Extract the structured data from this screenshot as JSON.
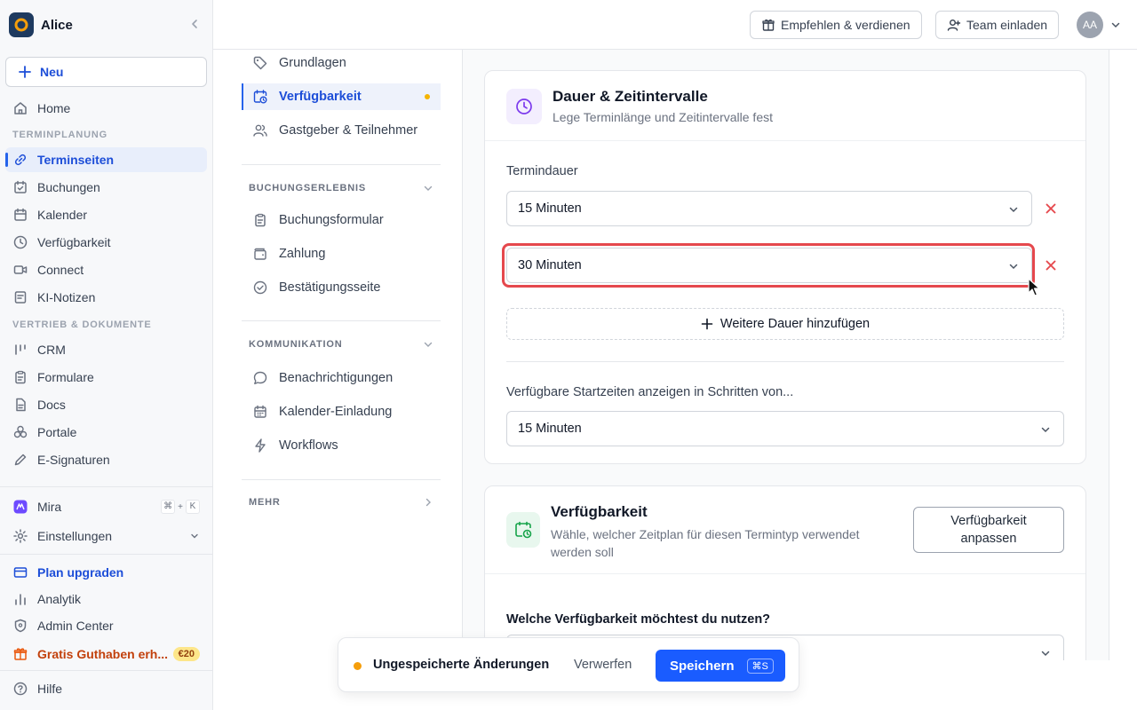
{
  "workspace": {
    "name": "Alice"
  },
  "sidebar": {
    "new_label": "Neu",
    "home": "Home",
    "section_scheduling": "TERMINPLANUNG",
    "scheduling_items": [
      {
        "label": "Terminseiten",
        "icon": "link-icon",
        "active": true
      },
      {
        "label": "Buchungen",
        "icon": "calendar-check-icon"
      },
      {
        "label": "Kalender",
        "icon": "calendar-icon"
      },
      {
        "label": "Verfügbarkeit",
        "icon": "clock-icon"
      },
      {
        "label": "Connect",
        "icon": "video-icon"
      },
      {
        "label": "KI-Notizen",
        "icon": "notes-icon"
      }
    ],
    "section_sales": "VERTRIEB & DOKUMENTE",
    "sales_items": [
      {
        "label": "CRM",
        "icon": "crm-icon"
      },
      {
        "label": "Formulare",
        "icon": "clipboard-icon"
      },
      {
        "label": "Docs",
        "icon": "document-icon"
      },
      {
        "label": "Portale",
        "icon": "portal-icon"
      },
      {
        "label": "E-Signaturen",
        "icon": "pen-icon"
      }
    ],
    "mira": {
      "label": "Mira",
      "shortcut_mod": "⌘",
      "shortcut_plus": "+",
      "shortcut_key": "K"
    },
    "settings": "Einstellungen",
    "plan_upgrade": "Plan upgraden",
    "analytics": "Analytik",
    "admin_center": "Admin Center",
    "credit": {
      "label": "Gratis Guthaben erh...",
      "badge": "€20"
    },
    "help": "Hilfe"
  },
  "topbar": {
    "refer": "Empfehlen & verdienen",
    "invite": "Team einladen",
    "avatar": "AA"
  },
  "subnav": {
    "items_top": [
      {
        "label": "Grundlagen",
        "icon": "tag-icon"
      },
      {
        "label": "Verfügbarkeit",
        "icon": "calendar-clock-icon",
        "active": true
      },
      {
        "label": "Gastgeber & Teilnehmer",
        "icon": "users-icon"
      }
    ],
    "section_booking": "BUCHUNGSERLEBNIS",
    "booking_items": [
      {
        "label": "Buchungsformular",
        "icon": "clipboard-icon"
      },
      {
        "label": "Zahlung",
        "icon": "wallet-icon"
      },
      {
        "label": "Bestätigungsseite",
        "icon": "check-circle-icon"
      }
    ],
    "section_communication": "KOMMUNIKATION",
    "communication_items": [
      {
        "label": "Benachrichtigungen",
        "icon": "chat-bubble-icon"
      },
      {
        "label": "Kalender-Einladung",
        "icon": "calendar-icon"
      },
      {
        "label": "Workflows",
        "icon": "bolt-icon"
      }
    ],
    "section_more": "MEHR"
  },
  "duration_card": {
    "title": "Dauer & Zeitintervalle",
    "subtitle": "Lege Terminlänge und Zeitintervalle fest",
    "duration_label": "Termindauer",
    "durations": [
      "15 Minuten",
      "30 Minuten"
    ],
    "add_more": "Weitere Dauer hinzufügen",
    "interval_label": "Verfügbare Startzeiten anzeigen in Schritten von...",
    "interval_value": "15 Minuten"
  },
  "availability_card": {
    "title": "Verfügbarkeit",
    "subtitle": "Wähle, welcher Zeitplan für diesen Termintyp verwendet werden soll",
    "button_line1": "Verfügbarkeit",
    "button_line2": "anpassen",
    "question": "Welche Verfügbarkeit möchtest du nutzen?"
  },
  "toast": {
    "message": "Ungespeicherte Änderungen",
    "discard": "Verwerfen",
    "save": "Speichern",
    "save_shortcut": "⌘S"
  },
  "colors": {
    "accent": "#1a5cff",
    "active_nav": "#1d4ed8",
    "highlight_border": "#e5484d",
    "remove_x": "#e5484d",
    "unsaved_dot": "#f59e0b"
  }
}
